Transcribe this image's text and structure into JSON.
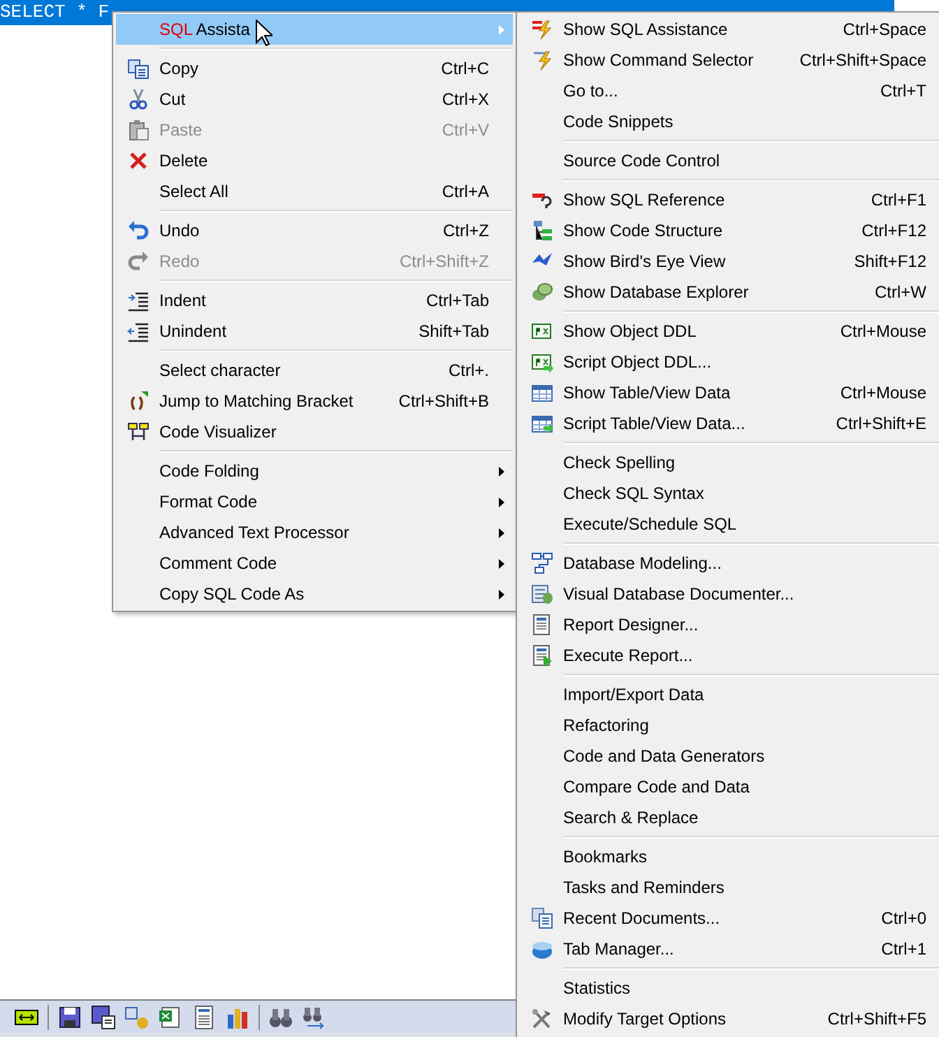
{
  "editor": {
    "selected_text": "SELECT * F"
  },
  "context_menu": {
    "items": [
      {
        "kind": "item",
        "prefix": "SQL",
        "label": "Assista",
        "submenu": true,
        "selected": true,
        "disabled": false
      },
      {
        "kind": "separator"
      },
      {
        "kind": "item",
        "label": "Copy",
        "shortcut": "Ctrl+C",
        "selected": false,
        "disabled": false
      },
      {
        "kind": "item",
        "label": "Cut",
        "shortcut": "Ctrl+X",
        "selected": false,
        "disabled": false
      },
      {
        "kind": "item",
        "label": "Paste",
        "shortcut": "Ctrl+V",
        "selected": false,
        "disabled": true
      },
      {
        "kind": "item",
        "label": "Delete",
        "selected": false,
        "disabled": false
      },
      {
        "kind": "item",
        "label": "Select All",
        "shortcut": "Ctrl+A",
        "selected": false,
        "disabled": false
      },
      {
        "kind": "separator"
      },
      {
        "kind": "item",
        "label": "Undo",
        "shortcut": "Ctrl+Z",
        "selected": false,
        "disabled": false
      },
      {
        "kind": "item",
        "label": "Redo",
        "shortcut": "Ctrl+Shift+Z",
        "selected": false,
        "disabled": true
      },
      {
        "kind": "separator"
      },
      {
        "kind": "item",
        "label": "Indent",
        "shortcut": "Ctrl+Tab",
        "selected": false,
        "disabled": false
      },
      {
        "kind": "item",
        "label": "Unindent",
        "shortcut": "Shift+Tab",
        "selected": false,
        "disabled": false
      },
      {
        "kind": "separator"
      },
      {
        "kind": "item",
        "label": "Select character",
        "shortcut": "Ctrl+.",
        "selected": false,
        "disabled": false
      },
      {
        "kind": "item",
        "label": "Jump to Matching Bracket",
        "shortcut": "Ctrl+Shift+B",
        "selected": false,
        "disabled": false
      },
      {
        "kind": "item",
        "label": "Code Visualizer",
        "selected": false,
        "disabled": false
      },
      {
        "kind": "separator"
      },
      {
        "kind": "item",
        "label": "Code Folding",
        "submenu": true,
        "selected": false,
        "disabled": false
      },
      {
        "kind": "item",
        "label": "Format Code",
        "submenu": true,
        "selected": false,
        "disabled": false
      },
      {
        "kind": "item",
        "label": "Advanced Text Processor",
        "submenu": true,
        "selected": false,
        "disabled": false
      },
      {
        "kind": "item",
        "label": "Comment Code",
        "submenu": true,
        "selected": false,
        "disabled": false
      },
      {
        "kind": "item",
        "label": "Copy SQL Code As",
        "submenu": true,
        "selected": false,
        "disabled": false
      }
    ]
  },
  "submenu": {
    "items": [
      {
        "kind": "item",
        "label": "Show SQL Assistance",
        "shortcut": "Ctrl+Space"
      },
      {
        "kind": "item",
        "label": "Show Command Selector",
        "shortcut": "Ctrl+Shift+Space"
      },
      {
        "kind": "item",
        "label": "Go to...",
        "shortcut": "Ctrl+T"
      },
      {
        "kind": "item",
        "label": "Code Snippets"
      },
      {
        "kind": "separator"
      },
      {
        "kind": "item",
        "label": "Source Code Control"
      },
      {
        "kind": "separator"
      },
      {
        "kind": "item",
        "label": "Show SQL Reference",
        "shortcut": "Ctrl+F1"
      },
      {
        "kind": "item",
        "label": "Show Code Structure",
        "shortcut": "Ctrl+F12"
      },
      {
        "kind": "item",
        "label": "Show Bird's Eye View",
        "shortcut": "Shift+F12"
      },
      {
        "kind": "item",
        "label": "Show Database Explorer",
        "shortcut": "Ctrl+W"
      },
      {
        "kind": "separator"
      },
      {
        "kind": "item",
        "label": "Show Object DDL",
        "shortcut": "Ctrl+Mouse"
      },
      {
        "kind": "item",
        "label": "Script Object DDL..."
      },
      {
        "kind": "item",
        "label": "Show Table/View Data",
        "shortcut": "Ctrl+Mouse"
      },
      {
        "kind": "item",
        "label": "Script Table/View Data...",
        "shortcut": "Ctrl+Shift+E"
      },
      {
        "kind": "separator"
      },
      {
        "kind": "item",
        "label": "Check Spelling"
      },
      {
        "kind": "item",
        "label": "Check SQL Syntax"
      },
      {
        "kind": "item",
        "label": "Execute/Schedule SQL"
      },
      {
        "kind": "separator"
      },
      {
        "kind": "item",
        "label": "Database Modeling..."
      },
      {
        "kind": "item",
        "label": "Visual Database Documenter..."
      },
      {
        "kind": "item",
        "label": "Report Designer..."
      },
      {
        "kind": "item",
        "label": "Execute Report..."
      },
      {
        "kind": "separator"
      },
      {
        "kind": "item",
        "label": "Import/Export Data"
      },
      {
        "kind": "item",
        "label": "Refactoring"
      },
      {
        "kind": "item",
        "label": "Code and Data Generators"
      },
      {
        "kind": "item",
        "label": "Compare Code and Data"
      },
      {
        "kind": "item",
        "label": "Search & Replace"
      },
      {
        "kind": "separator"
      },
      {
        "kind": "item",
        "label": "Bookmarks"
      },
      {
        "kind": "item",
        "label": "Tasks and Reminders"
      },
      {
        "kind": "item",
        "label": "Recent Documents...",
        "shortcut": "Ctrl+0"
      },
      {
        "kind": "item",
        "label": "Tab Manager...",
        "shortcut": "Ctrl+1"
      },
      {
        "kind": "separator"
      },
      {
        "kind": "item",
        "label": "Statistics"
      },
      {
        "kind": "item",
        "label": "Modify Target Options",
        "shortcut": "Ctrl+Shift+F5"
      }
    ]
  }
}
